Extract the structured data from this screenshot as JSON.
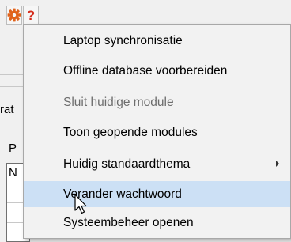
{
  "toolbar": {
    "gear_icon": "gear-icon",
    "help_label": "?",
    "gear_color": "#e0621a",
    "help_color": "#d42a1a"
  },
  "background": {
    "fragment_1": "rat",
    "fragment_2": "P",
    "fragment_3": "N"
  },
  "menu": {
    "items": [
      {
        "label": "Laptop synchronisatie",
        "enabled": true,
        "submenu": false
      },
      {
        "label": "Offline database voorbereiden",
        "enabled": true,
        "submenu": false
      },
      {
        "label": "Sluit huidige module",
        "enabled": false,
        "submenu": false
      },
      {
        "label": "Toon geopende modules",
        "enabled": true,
        "submenu": false
      },
      {
        "label": "Huidig standaardthema",
        "enabled": true,
        "submenu": true
      },
      {
        "label": "Verander wachtwoord",
        "enabled": true,
        "submenu": false,
        "hovered": true
      },
      {
        "label": "Systeembeheer openen",
        "enabled": true,
        "submenu": false
      }
    ]
  },
  "colors": {
    "hover_bg": "#cce0f5",
    "menu_bg": "#f2f2f2",
    "disabled_text": "#6d6d6d"
  }
}
